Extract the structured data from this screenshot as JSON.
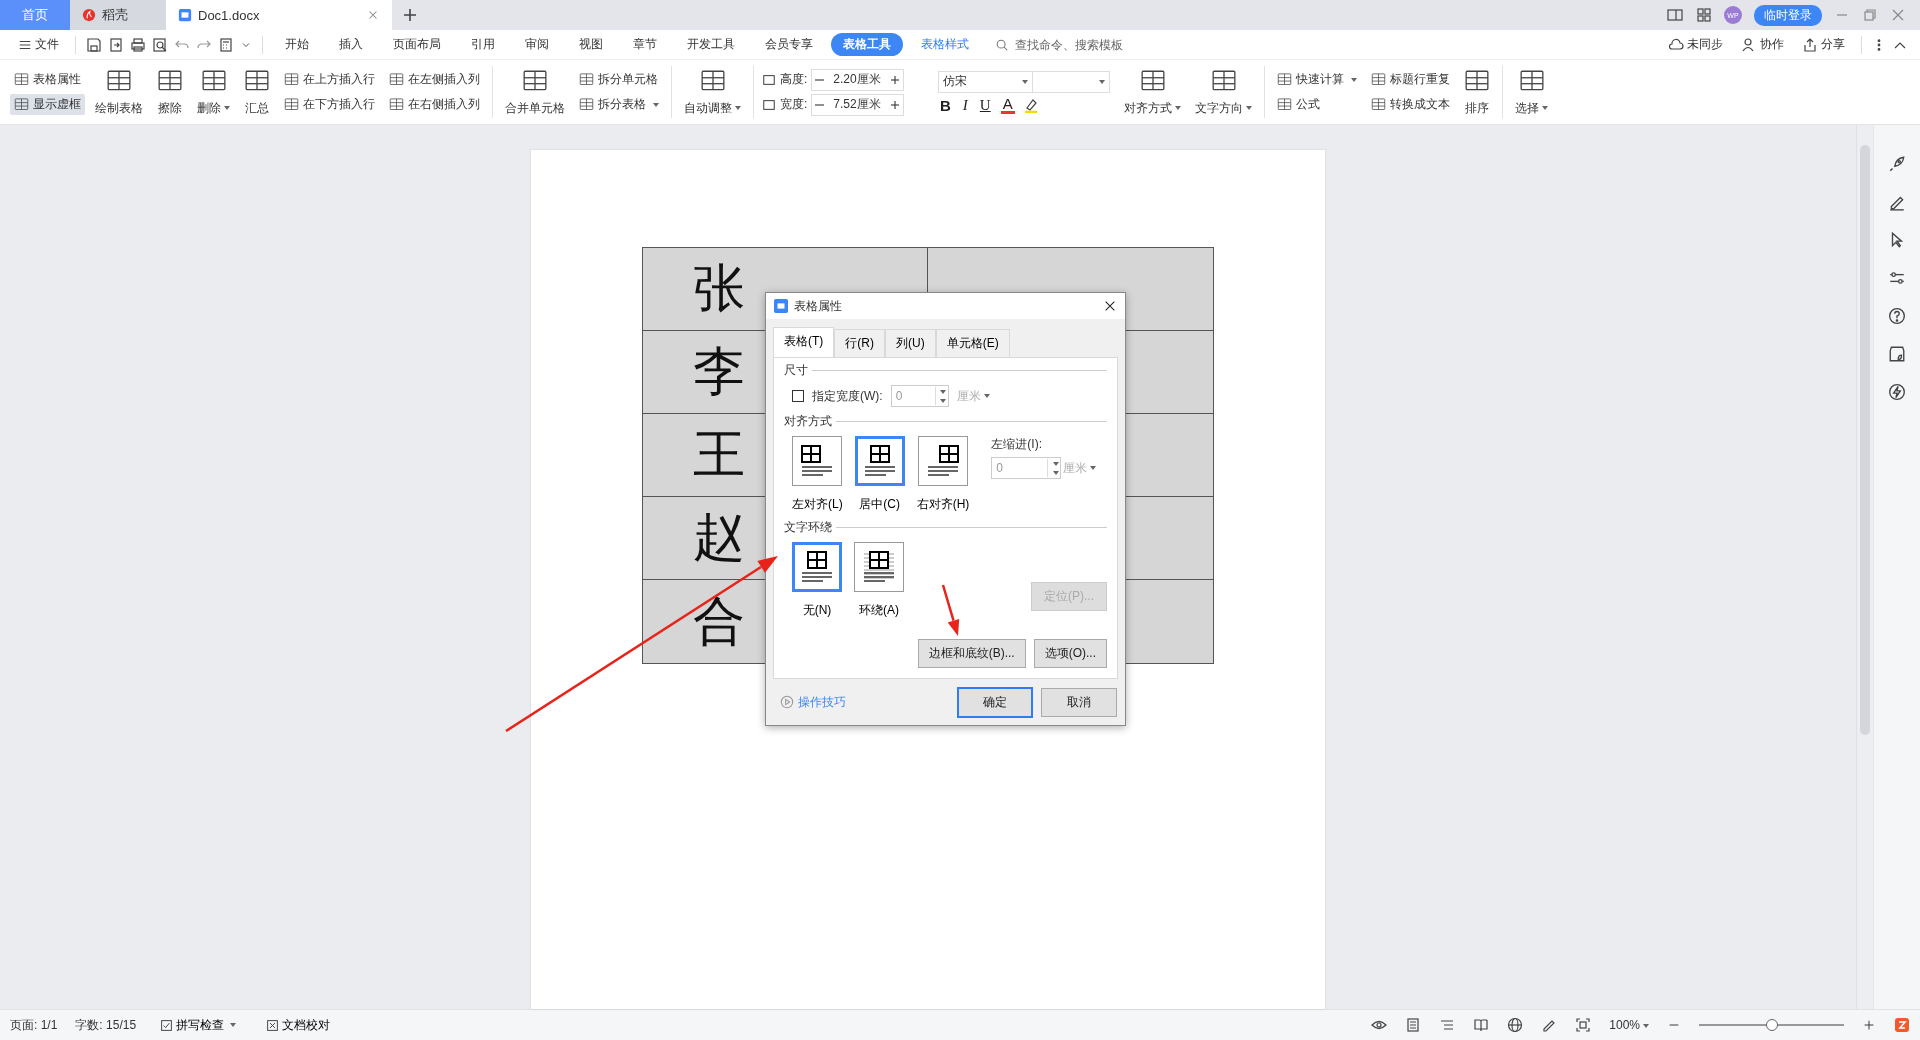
{
  "title_bar": {
    "tabs": [
      {
        "label": "首页",
        "kind": "home",
        "selected": false
      },
      {
        "label": "稻壳",
        "kind": "docer",
        "selected": false
      },
      {
        "label": "Doc1.docx",
        "kind": "doc",
        "selected": true
      }
    ],
    "avatar": "WP",
    "login": "临时登录"
  },
  "menu_bar": {
    "file": "文件",
    "items": [
      {
        "label": "开始",
        "selected": false,
        "contextual": false
      },
      {
        "label": "插入",
        "selected": false,
        "contextual": false
      },
      {
        "label": "页面布局",
        "selected": false,
        "contextual": false
      },
      {
        "label": "引用",
        "selected": false,
        "contextual": false
      },
      {
        "label": "审阅",
        "selected": false,
        "contextual": false
      },
      {
        "label": "视图",
        "selected": false,
        "contextual": false
      },
      {
        "label": "章节",
        "selected": false,
        "contextual": false
      },
      {
        "label": "开发工具",
        "selected": false,
        "contextual": false
      },
      {
        "label": "会员专享",
        "selected": false,
        "contextual": false
      },
      {
        "label": "表格工具",
        "selected": true,
        "contextual": true
      },
      {
        "label": "表格样式",
        "selected": false,
        "contextual": true
      }
    ],
    "search": {
      "placeholder": "查找命令、搜索模板"
    },
    "actions": [
      "未同步",
      "协作",
      "分享"
    ]
  },
  "ribbon": [
    {
      "kind": "stack",
      "items": [
        {
          "label": "表格属性",
          "on": false,
          "dropdown": false
        },
        {
          "label": "显示虚框",
          "on": true,
          "dropdown": false
        }
      ]
    },
    {
      "kind": "big",
      "label": "绘制表格",
      "dropdown": false
    },
    {
      "kind": "big",
      "label": "擦除",
      "dropdown": false
    },
    {
      "kind": "big",
      "label": "删除",
      "dropdown": true
    },
    {
      "kind": "big",
      "label": "汇总",
      "dropdown": false
    },
    {
      "kind": "stack",
      "items": [
        {
          "label": "在上方插入行",
          "on": false,
          "dropdown": false
        },
        {
          "label": "在下方插入行",
          "on": false,
          "dropdown": false
        }
      ]
    },
    {
      "kind": "stack",
      "items": [
        {
          "label": "在左侧插入列",
          "on": false,
          "dropdown": false
        },
        {
          "label": "在右侧插入列",
          "on": false,
          "dropdown": false
        }
      ]
    },
    {
      "kind": "separator"
    },
    {
      "kind": "big",
      "label": "合并单元格",
      "dropdown": false
    },
    {
      "kind": "stack",
      "items": [
        {
          "label": "拆分单元格",
          "on": false,
          "dropdown": false
        },
        {
          "label": "拆分表格",
          "on": false,
          "dropdown": true
        }
      ]
    },
    {
      "kind": "separator"
    },
    {
      "kind": "big",
      "label": "自动调整",
      "dropdown": true
    },
    {
      "kind": "separator"
    },
    {
      "kind": "size",
      "fields": [
        {
          "label": "高度:",
          "value": "2.20厘米"
        },
        {
          "label": "宽度:",
          "value": "7.52厘米"
        }
      ]
    },
    {
      "kind": "font",
      "font": "仿宋",
      "formats": [
        {
          "label": "B",
          "kind": "bold"
        },
        {
          "label": "I",
          "kind": "italic"
        },
        {
          "label": "U",
          "kind": "underline"
        },
        {
          "label": "A",
          "kind": "color"
        }
      ]
    },
    {
      "kind": "big",
      "label": "对齐方式",
      "dropdown": true
    },
    {
      "kind": "big",
      "label": "文字方向",
      "dropdown": true
    },
    {
      "kind": "separator"
    },
    {
      "kind": "stack",
      "items": [
        {
          "label": "快速计算",
          "on": false,
          "dropdown": true
        },
        {
          "label": "公式",
          "on": false,
          "dropdown": false
        }
      ]
    },
    {
      "kind": "stack",
      "items": [
        {
          "label": "标题行重复",
          "on": false,
          "dropdown": false
        },
        {
          "label": "转换成文本",
          "on": false,
          "dropdown": false
        }
      ]
    },
    {
      "kind": "big",
      "label": "排序",
      "dropdown": false
    },
    {
      "kind": "separator"
    },
    {
      "kind": "big",
      "label": "选择",
      "dropdown": true
    }
  ],
  "document": {
    "table_rows": [
      {
        "column_1": "张"
      },
      {
        "column_1": "李"
      },
      {
        "column_1": "王"
      },
      {
        "column_1": "赵"
      },
      {
        "column_1": "合"
      }
    ]
  },
  "dialog": {
    "title": "表格属性",
    "tabs": [
      {
        "label": "表格(T)",
        "selected": true
      },
      {
        "label": "行(R)",
        "selected": false
      },
      {
        "label": "列(U)",
        "selected": false
      },
      {
        "label": "单元格(E)",
        "selected": false
      }
    ],
    "size": {
      "legend": "尺寸",
      "checkbox": {
        "label": "指定宽度(W):",
        "checked": false
      },
      "value": "0",
      "unit": "厘米"
    },
    "alignment": {
      "legend": "对齐方式",
      "options": [
        {
          "label": "左对齐(L)",
          "selected": false
        },
        {
          "label": "居中(C)",
          "selected": true
        },
        {
          "label": "右对齐(H)",
          "selected": false
        }
      ],
      "indent_label": "左缩进(I):",
      "indent_value": "0",
      "unit": "厘米"
    },
    "wrapping": {
      "legend": "文字环绕",
      "options": [
        {
          "label": "无(N)",
          "selected": true
        },
        {
          "label": "环绕(A)",
          "selected": false
        }
      ],
      "position_button": {
        "label": "定位(P)...",
        "disabled": true
      }
    },
    "buttons": [
      {
        "label": "边框和底纹(B)..."
      },
      {
        "label": "选项(O)..."
      }
    ],
    "tips_link": "操作技巧",
    "footer_buttons": [
      {
        "label": "确定",
        "default": true
      },
      {
        "label": "取消",
        "default": false
      }
    ]
  },
  "status_bar": {
    "page": "页面: 1/1",
    "words": "字数: 15/15",
    "spell_check": {
      "label": "拼写检查",
      "checked": true
    },
    "proofread": "文档校对",
    "zoom": "100%",
    "zoom_slider": {
      "level": 0.5
    }
  }
}
